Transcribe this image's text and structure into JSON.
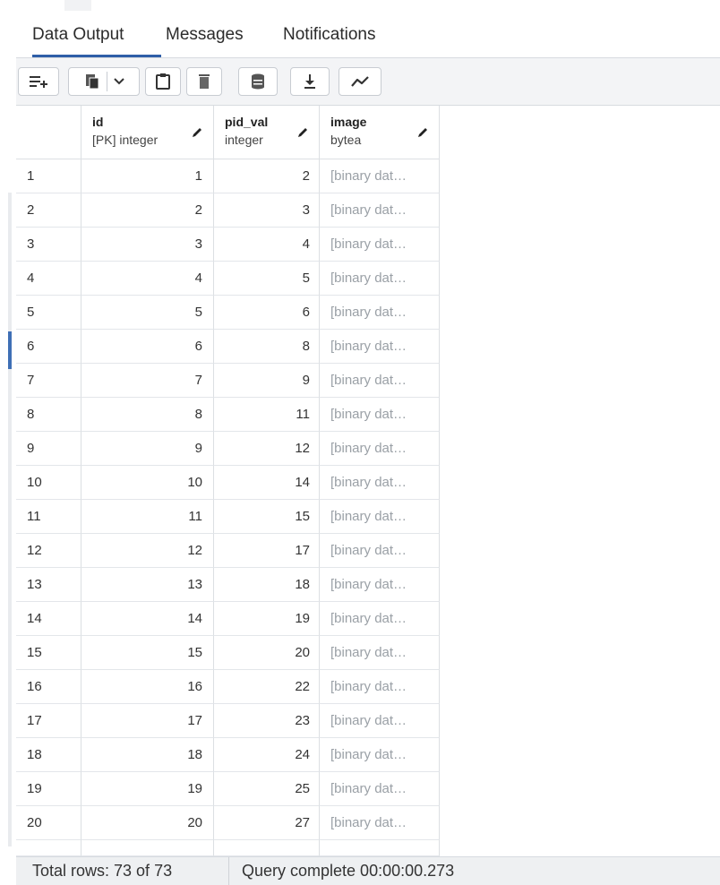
{
  "tabs": [
    {
      "label": "Data Output"
    },
    {
      "label": "Messages"
    },
    {
      "label": "Notifications"
    }
  ],
  "toolbar": {
    "icons": [
      "add-row-icon",
      "copy-icon",
      "chevron-down-icon",
      "paste-icon",
      "delete-icon",
      "save-data-icon",
      "download-icon",
      "graph-visualiser-icon"
    ]
  },
  "grid": {
    "columns": [
      {
        "name": "id",
        "type": "[PK] integer"
      },
      {
        "name": "pid_val",
        "type": "integer"
      },
      {
        "name": "image",
        "type": "bytea"
      }
    ],
    "rows": [
      {
        "rn": "1",
        "id": "1",
        "pid": "2",
        "img": "[binary dat…"
      },
      {
        "rn": "2",
        "id": "2",
        "pid": "3",
        "img": "[binary dat…"
      },
      {
        "rn": "3",
        "id": "3",
        "pid": "4",
        "img": "[binary dat…"
      },
      {
        "rn": "4",
        "id": "4",
        "pid": "5",
        "img": "[binary dat…"
      },
      {
        "rn": "5",
        "id": "5",
        "pid": "6",
        "img": "[binary dat…"
      },
      {
        "rn": "6",
        "id": "6",
        "pid": "8",
        "img": "[binary dat…"
      },
      {
        "rn": "7",
        "id": "7",
        "pid": "9",
        "img": "[binary dat…"
      },
      {
        "rn": "8",
        "id": "8",
        "pid": "11",
        "img": "[binary dat…"
      },
      {
        "rn": "9",
        "id": "9",
        "pid": "12",
        "img": "[binary dat…"
      },
      {
        "rn": "10",
        "id": "10",
        "pid": "14",
        "img": "[binary dat…"
      },
      {
        "rn": "11",
        "id": "11",
        "pid": "15",
        "img": "[binary dat…"
      },
      {
        "rn": "12",
        "id": "12",
        "pid": "17",
        "img": "[binary dat…"
      },
      {
        "rn": "13",
        "id": "13",
        "pid": "18",
        "img": "[binary dat…"
      },
      {
        "rn": "14",
        "id": "14",
        "pid": "19",
        "img": "[binary dat…"
      },
      {
        "rn": "15",
        "id": "15",
        "pid": "20",
        "img": "[binary dat…"
      },
      {
        "rn": "16",
        "id": "16",
        "pid": "22",
        "img": "[binary dat…"
      },
      {
        "rn": "17",
        "id": "17",
        "pid": "23",
        "img": "[binary dat…"
      },
      {
        "rn": "18",
        "id": "18",
        "pid": "24",
        "img": "[binary dat…"
      },
      {
        "rn": "19",
        "id": "19",
        "pid": "25",
        "img": "[binary dat…"
      },
      {
        "rn": "20",
        "id": "20",
        "pid": "27",
        "img": "[binary dat…"
      }
    ]
  },
  "status": {
    "total_rows": "Total rows: 73 of 73",
    "query": "Query complete 00:00:00.273"
  },
  "colors": {
    "accent": "#2f5fa8",
    "toolbar_bg": "#f3f4f6",
    "grid_line": "#dcdfe3",
    "muted_text": "#9aa0a6"
  }
}
